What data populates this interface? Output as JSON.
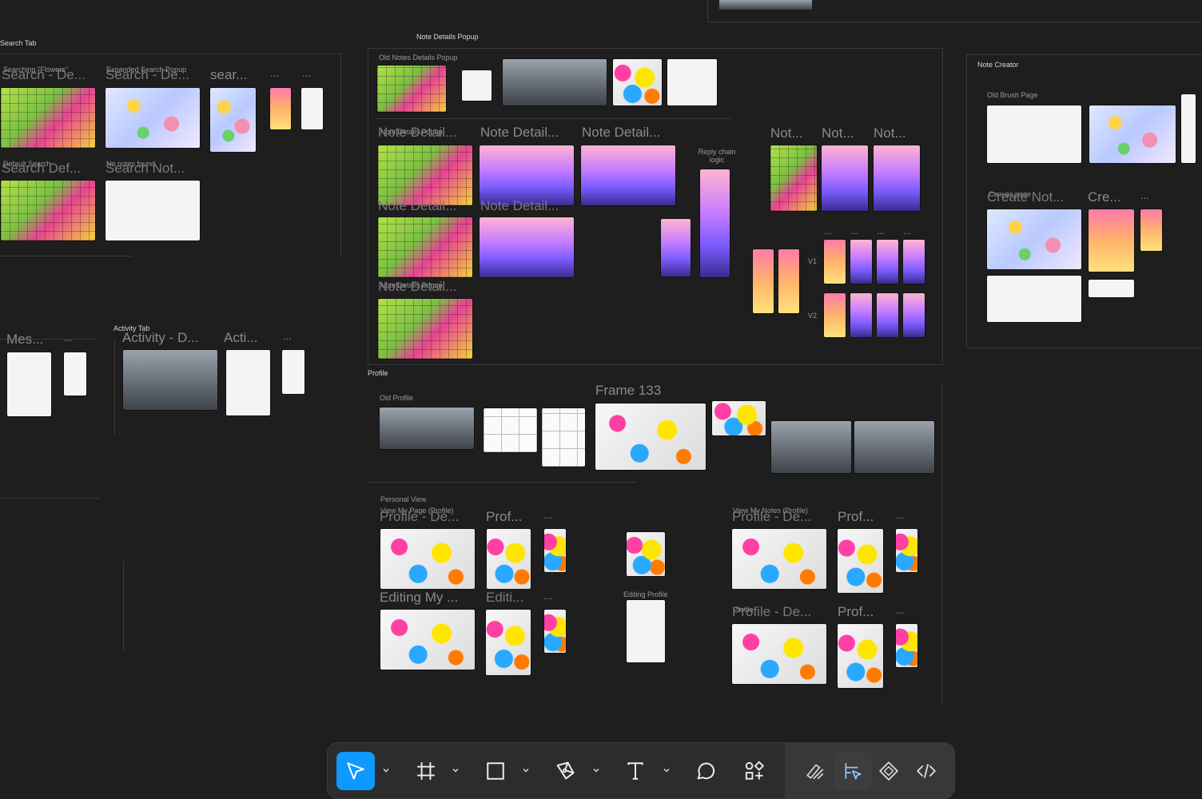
{
  "sections": {
    "search_tab": "Search Tab",
    "note_details_popup": "Note Details Popup",
    "old_notes_details_popup": "Old Notes Details Popup",
    "note_creator": "Note Creator",
    "old_brush_page": "Old Brush Page",
    "activity_tab": "Activity Tab",
    "profile": "Profile",
    "old_profile": "Old Profile",
    "frame_133": "Frame 133",
    "personal_view": "Personal View",
    "editing_profile": "Editing Profile",
    "reply_chain_logic": "Reply chain logic",
    "v1": "V1",
    "v2": "V2"
  },
  "search_frames": {
    "row1_sub": [
      "Searching \"Flowers\"",
      "Expanded Search Popup"
    ],
    "row1": [
      "Search - De...",
      "Search - De...",
      "sear...",
      "...",
      "..."
    ],
    "row2_sub": [
      "Default Search",
      "No notes found"
    ],
    "row2": [
      "Search Def...",
      "Search Not..."
    ]
  },
  "note_detail_frames": {
    "top": [
      "Note Detail...",
      "Note Detail...",
      "Note Detail..."
    ],
    "top_sub": "Note Details Popup",
    "mid": [
      "Note Detail...",
      "Note Detail..."
    ],
    "bottom": "Note Detail...",
    "bottom_sub": "Note Details Popup",
    "nots": [
      "Not...",
      "Not...",
      "Not..."
    ],
    "dots": [
      "...",
      "...",
      "...",
      "..."
    ]
  },
  "note_creator_frames": {
    "sub": "Canvas page",
    "titles": [
      "Create Not...",
      "Cre...",
      "..."
    ]
  },
  "activity_frames": {
    "left": [
      "Mes...",
      "..."
    ],
    "titles": [
      "Activity - D...",
      "Acti...",
      "..."
    ]
  },
  "profile_frames": {
    "left_sub": "View My Page (Profile)",
    "left_row1": [
      "Profile - De...",
      "Prof...",
      "..."
    ],
    "left_row2": [
      "Editing My ...",
      "Editi...",
      "..."
    ],
    "right_sub1": "View My Notes (Profile)",
    "right_row1": [
      "Profile - De...",
      "Prof...",
      "..."
    ],
    "right_sub2": "Profile",
    "right_row2": [
      "Profile - De...",
      "Prof...",
      "..."
    ]
  },
  "toolbar": {
    "tools": [
      "move-tool",
      "frame-tool",
      "shape-tool",
      "pen-tool",
      "text-tool",
      "comment-tool",
      "actions-tool"
    ],
    "right_tools": [
      "draw-mode",
      "design-mode",
      "prototype-mode",
      "dev-mode"
    ],
    "accent": "#0d99ff"
  }
}
